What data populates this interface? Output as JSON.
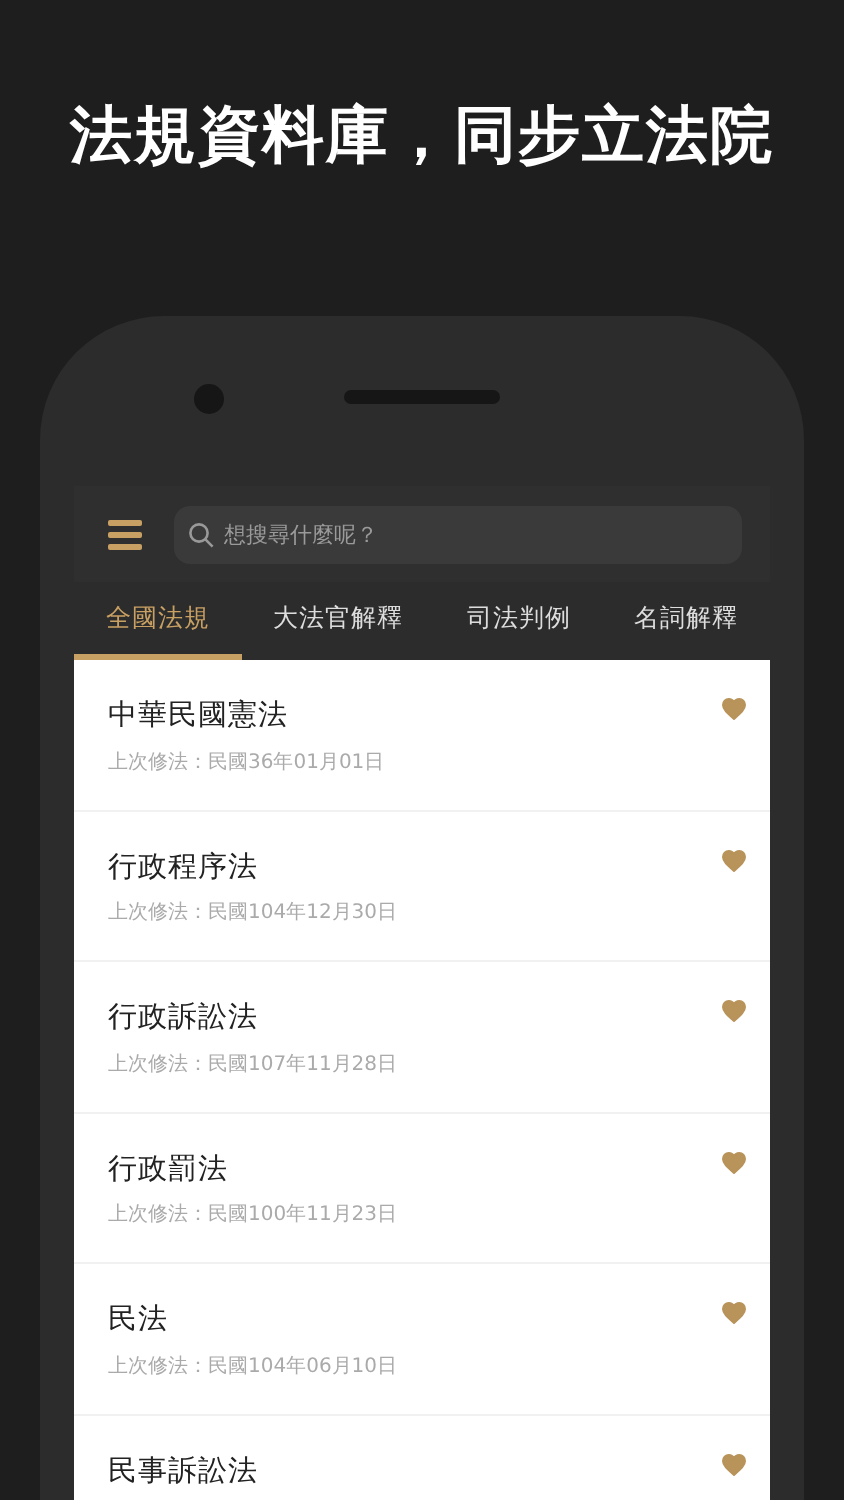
{
  "headline": "法規資料庫，同步立法院",
  "search": {
    "placeholder": "想搜尋什麼呢？"
  },
  "tabs": [
    {
      "label": "全國法規",
      "selected": true
    },
    {
      "label": "大法官解釋",
      "selected": false
    },
    {
      "label": "司法判例",
      "selected": false
    },
    {
      "label": "名詞解釋",
      "selected": false
    }
  ],
  "laws": [
    {
      "title": "中華民國憲法",
      "subtitle": "上次修法：民國36年01月01日",
      "favorite": true
    },
    {
      "title": "行政程序法",
      "subtitle": "上次修法：民國104年12月30日",
      "favorite": true
    },
    {
      "title": "行政訴訟法",
      "subtitle": "上次修法：民國107年11月28日",
      "favorite": true
    },
    {
      "title": "行政罰法",
      "subtitle": "上次修法：民國100年11月23日",
      "favorite": true
    },
    {
      "title": "民法",
      "subtitle": "上次修法：民國104年06月10日",
      "favorite": true
    },
    {
      "title": "民事訴訟法",
      "favorite": true
    }
  ]
}
